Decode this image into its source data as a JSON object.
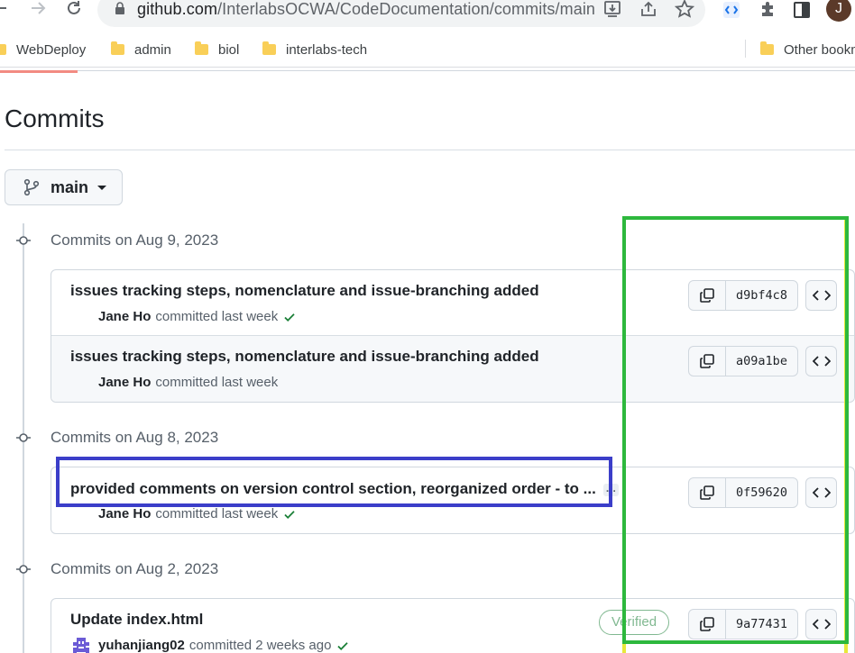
{
  "browser": {
    "url_prefix": "github.com",
    "url_path": "/InterlabsOCWA/CodeDocumentation/commits/main",
    "profile_initial": "J",
    "bookmarks": [
      {
        "label": "WebDeploy"
      },
      {
        "label": "admin"
      },
      {
        "label": "biol"
      },
      {
        "label": "interlabs-tech"
      }
    ],
    "other_bookmarks": "Other bookm"
  },
  "page": {
    "title": "Commits",
    "branch": "main"
  },
  "groups": [
    {
      "heading": "Commits on Aug 9, 2023",
      "commits": [
        {
          "message": "issues tracking steps, nomenclature and issue-branching added",
          "author": "Jane Ho",
          "time": "committed last week",
          "sha": "d9bf4c8",
          "status": "success"
        },
        {
          "message": "issues tracking steps, nomenclature and issue-branching added",
          "author": "Jane Ho",
          "time": "committed last week",
          "sha": "a09a1be",
          "status": "none"
        }
      ]
    },
    {
      "heading": "Commits on Aug 8, 2023",
      "commits": [
        {
          "message": "provided comments on version control section, reorganized order - to ...",
          "author": "Jane Ho",
          "time": "committed last week",
          "sha": "0f59620",
          "status": "success"
        }
      ]
    },
    {
      "heading": "Commits on Aug 2, 2023",
      "commits": [
        {
          "message": "Update index.html",
          "author": "yuhanjiang02",
          "time": "committed 2 weeks ago",
          "sha": "9a77431",
          "status": "success",
          "badge": "Verified"
        }
      ]
    }
  ],
  "colors": {
    "annotation_blue": "#3b3ec9",
    "annotation_green": "#2db83d",
    "annotation_yellow": "#e8e83a",
    "success": "#1a7f37"
  }
}
